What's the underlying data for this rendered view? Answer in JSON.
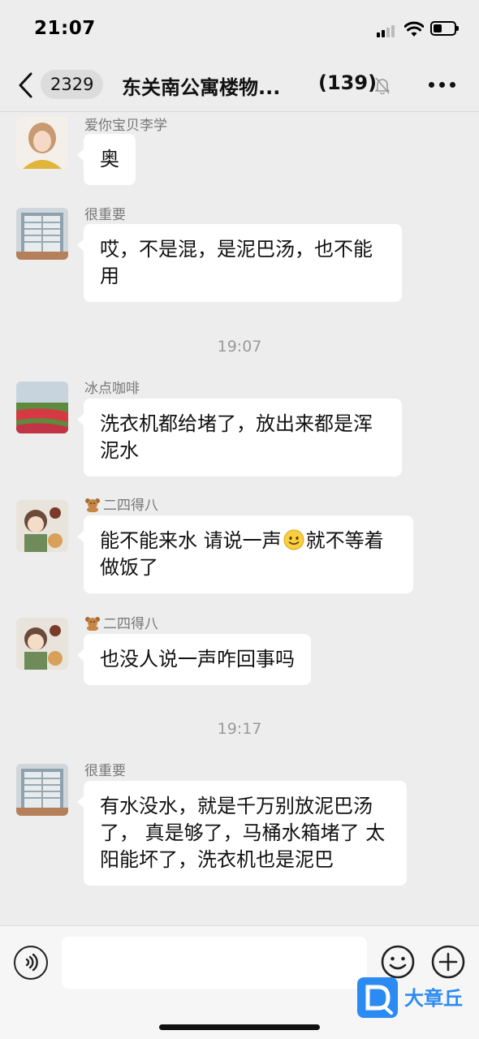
{
  "status_bar": {
    "time": "21:07"
  },
  "nav": {
    "unread_count": "2329",
    "title": "东关南公寓楼物...",
    "member_count": "(139)"
  },
  "messages": [
    {
      "sender": "爱你宝贝李学",
      "text": "奥",
      "avatar": "avatar-girl"
    },
    {
      "sender": "很重要",
      "text": "哎，不是混，是泥巴汤，也不能用",
      "avatar": "avatar-window"
    },
    {
      "time": "19:07"
    },
    {
      "sender": "冰点咖啡",
      "text": "洗衣机都给堵了，放出来都是浑泥水",
      "avatar": "avatar-flowerfield"
    },
    {
      "sender": "二四得八",
      "sender_icon": "bear-icon",
      "text_before": "能不能来水 请说一声",
      "inline_icon": "smiley-icon",
      "text_after": "就不等着做饭了",
      "avatar": "avatar-cartoon"
    },
    {
      "sender": "二四得八",
      "sender_icon": "bear-icon",
      "text": "也没人说一声咋回事吗",
      "avatar": "avatar-cartoon"
    },
    {
      "time": "19:17"
    },
    {
      "sender": "很重要",
      "text": "有水没水，就是千万别放泥巴汤了， 真是够了，马桶水箱堵了 太阳能坏了，洗衣机也是泥巴",
      "avatar": "avatar-window"
    }
  ],
  "input_bar": {
    "placeholder": "",
    "icons": [
      "voice-icon",
      "emoji-icon",
      "add-icon"
    ]
  },
  "watermark": {
    "text": "大章丘"
  },
  "colors": {
    "background": "#ededed",
    "bubble": "#ffffff",
    "watermark": "#2b8bf2"
  }
}
